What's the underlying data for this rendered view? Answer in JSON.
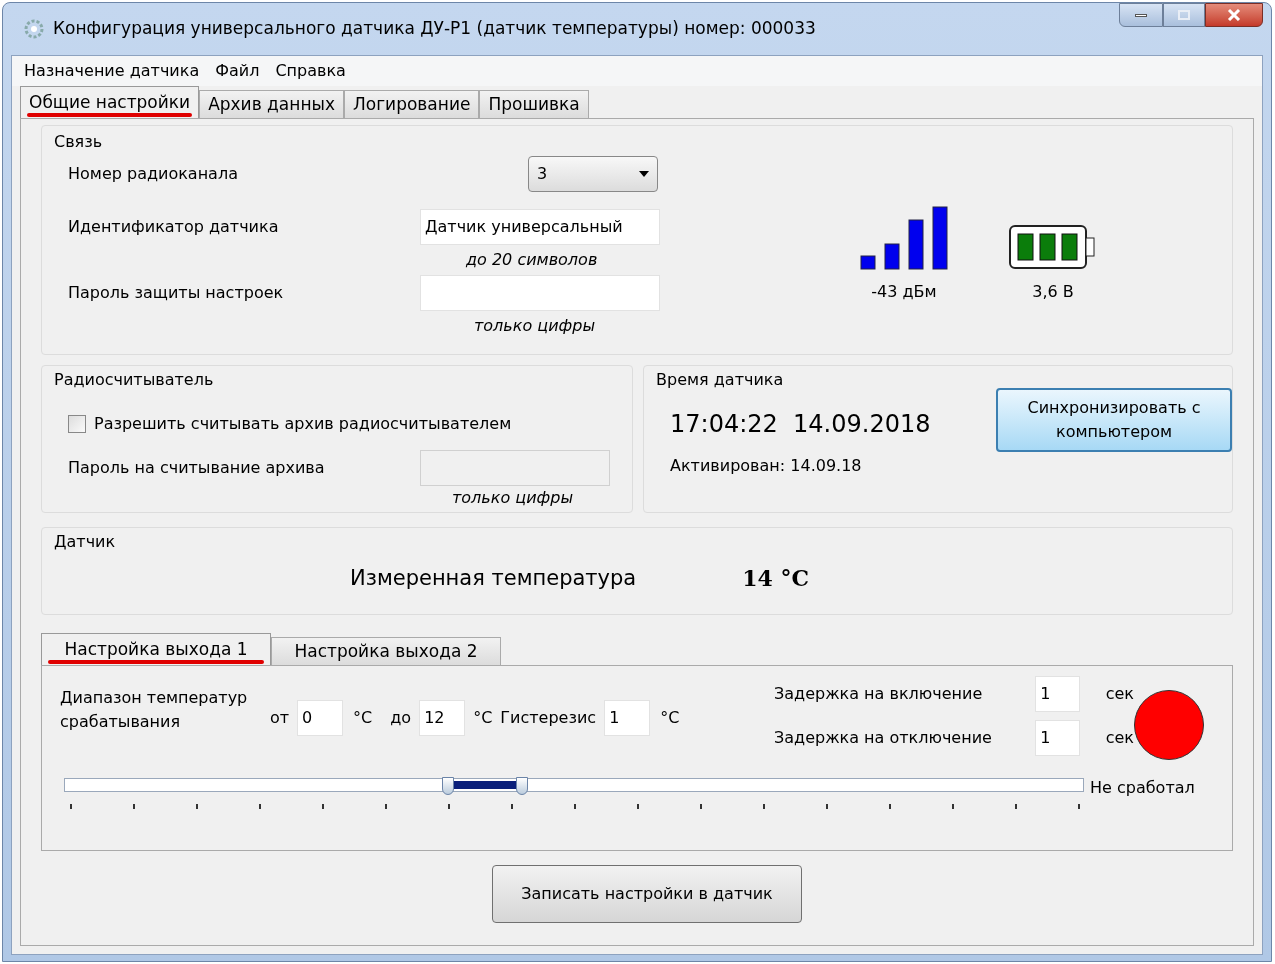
{
  "window": {
    "title": "Конфигурация универсального датчика ДУ-Р1 (датчик температуры) номер: 000033"
  },
  "menu": [
    "Назначение датчика",
    "Файл",
    "Справка"
  ],
  "tabs": [
    {
      "label": "Общие настройки",
      "selected": true
    },
    {
      "label": "Архив данных",
      "selected": false
    },
    {
      "label": "Логирование",
      "selected": false
    },
    {
      "label": "Прошивка",
      "selected": false
    }
  ],
  "link": {
    "title": "Связь",
    "channel_label": "Номер радиоканала",
    "channel_value": "3",
    "id_label": "Идентификатор датчика",
    "id_value": "Датчик универсальный",
    "id_hint": "до 20 символов",
    "password_label": "Пароль защиты настроек",
    "password_hint": "только цифры",
    "signal_reading": "-43 дБм",
    "battery_reading": "3,6 В"
  },
  "reader": {
    "title": "Радиосчитыватель",
    "allow_label": "Разрешить считывать архив радиосчитывателем",
    "allow_checked": false,
    "password_label": "Пароль на считывание архива",
    "password_disabled": true,
    "password_hint": "только цифры"
  },
  "time": {
    "title": "Время датчика",
    "clock": "17:04:22  14.09.2018",
    "activated": "Активирован: 14.09.18",
    "sync_button": "Синхронизировать с компьютером"
  },
  "sensor": {
    "title": "Датчик",
    "label": "Измеренная температура",
    "value": "14 °С"
  },
  "output_tabs": [
    {
      "label": "Настройка выхода 1",
      "selected": true
    },
    {
      "label": "Настройка выхода 2",
      "selected": false
    }
  ],
  "output": {
    "range_label": "Диапазон температур срабатывания",
    "from_label": "от",
    "from_value": "0",
    "from_unit": "°С",
    "to_label": "до",
    "to_value": "12",
    "to_unit": "°С",
    "hysteresis_label": "Гистерезис",
    "hysteresis_value": "1",
    "hysteresis_unit": "°С",
    "on_delay_label": "Задержка на включение",
    "on_delay_value": "1",
    "on_delay_unit": "сек",
    "off_delay_label": "Задержка на отключение",
    "off_delay_value": "1",
    "off_delay_unit": "сек",
    "triggered": false,
    "indicator_label": "Не сработал",
    "slider": [
      {
        "level": 0.376
      },
      {
        "level": 0.449
      }
    ]
  },
  "write_button": "Записать настройки в датчик"
}
